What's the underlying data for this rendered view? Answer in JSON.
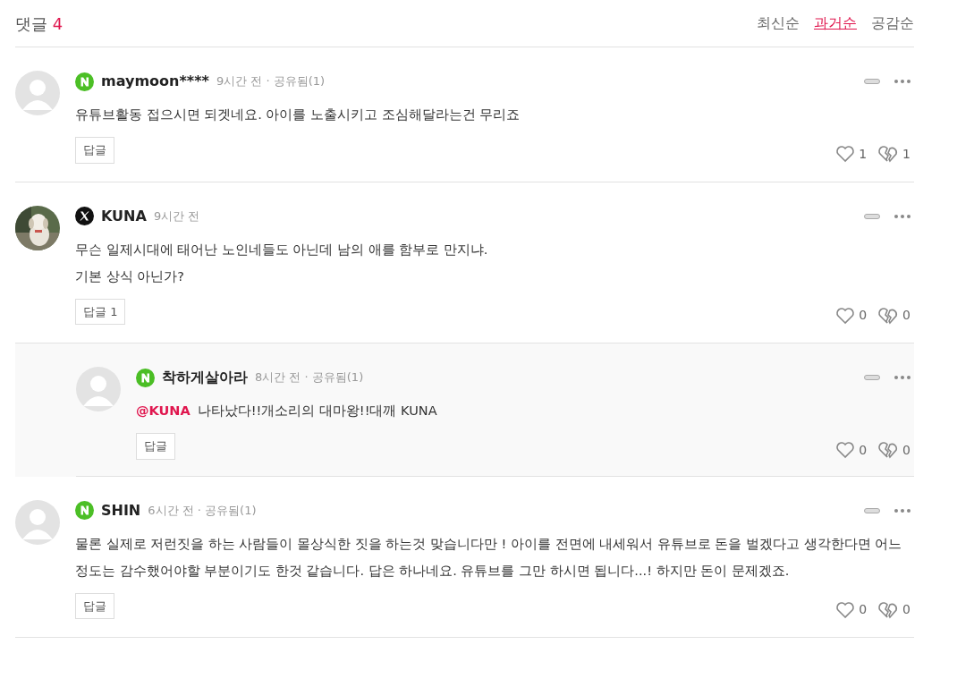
{
  "header": {
    "label": "댓글",
    "count": "4"
  },
  "sort_tabs": [
    {
      "label": "최신순",
      "selected": false
    },
    {
      "label": "과거순",
      "selected": true
    },
    {
      "label": "공감순",
      "selected": false
    }
  ],
  "comments": [
    {
      "avatar": {
        "kind": "default"
      },
      "badge": {
        "kind": "naver"
      },
      "author": "maymoon****",
      "meta": "9시간 전 · 공유됨(1)",
      "text": "유튜브활동 접으시면 되겟네요. 아이를 노출시키고 조심해달라는건 무리죠",
      "reply_button": "답글",
      "likes": "1",
      "dislikes": "1",
      "is_reply": false
    },
    {
      "badge": {
        "kind": "x"
      },
      "author": "KUNA",
      "meta": "9시간 전",
      "text": "무슨 일제시대에 태어난 노인네들도 아닌데 남의 애를 함부로 만지냐.\n기본 상식 아닌가?",
      "reply_button": "답글 1",
      "likes": "0",
      "dislikes": "0",
      "is_reply": false
    },
    {
      "avatar": {
        "kind": "default"
      },
      "badge": {
        "kind": "naver"
      },
      "author": "착하게살아라",
      "meta": "8시간 전 · 공유됨(1)",
      "mention": "@KUNA",
      "text": "나타났다!!개소리의 대마왕!!대깨 KUNA",
      "reply_button": "답글",
      "likes": "0",
      "dislikes": "0",
      "is_reply": true
    },
    {
      "avatar": {
        "kind": "default"
      },
      "badge": {
        "kind": "naver"
      },
      "author": "SHIN",
      "meta": "6시간 전 · 공유됨(1)",
      "text": "물론 실제로 저런짓을 하는 사람들이 몰상식한 짓을 하는것 맞습니다만 ! 아이를 전면에 내세워서 유튜브로 돈을 벌겠다고 생각한다면 어느정도는 감수했어야할 부분이기도 한것 같습니다. 답은 하나네요. 유튜브를 그만 하시면 됩니다...! 하지만 돈이 문제겠죠.",
      "reply_button": "답글",
      "likes": "0",
      "dislikes": "0",
      "is_reply": false
    }
  ]
}
